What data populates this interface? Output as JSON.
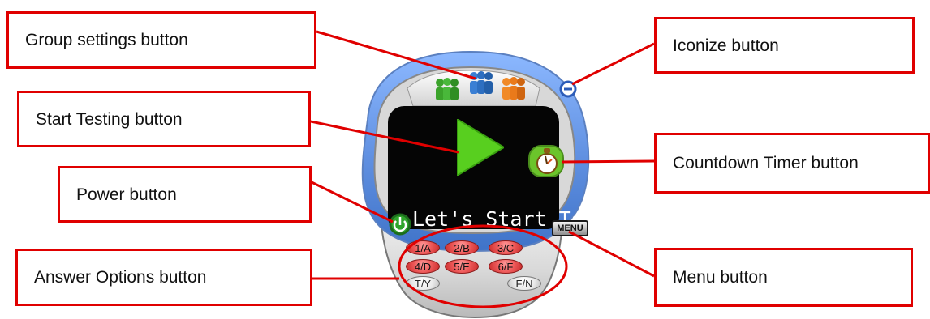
{
  "callouts": {
    "group_settings": "Group settings button",
    "start_testing": "Start Testing button",
    "power": "Power button",
    "answer_options": "Answer Options button",
    "iconize": "Iconize button",
    "countdown_timer": "Countdown Timer button",
    "menu": "Menu button"
  },
  "device": {
    "screen_text": "Let's Start Te",
    "menu_label": "MENU",
    "answer_options": [
      {
        "label": "1/A",
        "tone": "red"
      },
      {
        "label": "2/B",
        "tone": "red"
      },
      {
        "label": "3/C",
        "tone": "red"
      },
      {
        "label": "4/D",
        "tone": "red"
      },
      {
        "label": "5/E",
        "tone": "red"
      },
      {
        "label": "6/F",
        "tone": "red"
      },
      {
        "label": "T/Y",
        "tone": "gray"
      },
      {
        "label": "F/N",
        "tone": "gray"
      }
    ]
  },
  "icons": {
    "group_left": "green-group-icon",
    "group_center": "blue-group-icon",
    "group_right": "orange-group-icon",
    "iconize": "minus-icon",
    "start": "play-icon",
    "timer": "stopwatch-icon",
    "power": "power-icon"
  },
  "colors": {
    "callout_border": "#e00000",
    "device_blue": "#6f9ee8",
    "screen_black": "#050505",
    "play_green": "#58cf1f",
    "timer_green": "#6bc42b",
    "answer_red": "#ee5a5a",
    "group_green": "#3ba32b",
    "group_blue": "#2d6fc1",
    "group_orange": "#ea7a1a"
  }
}
